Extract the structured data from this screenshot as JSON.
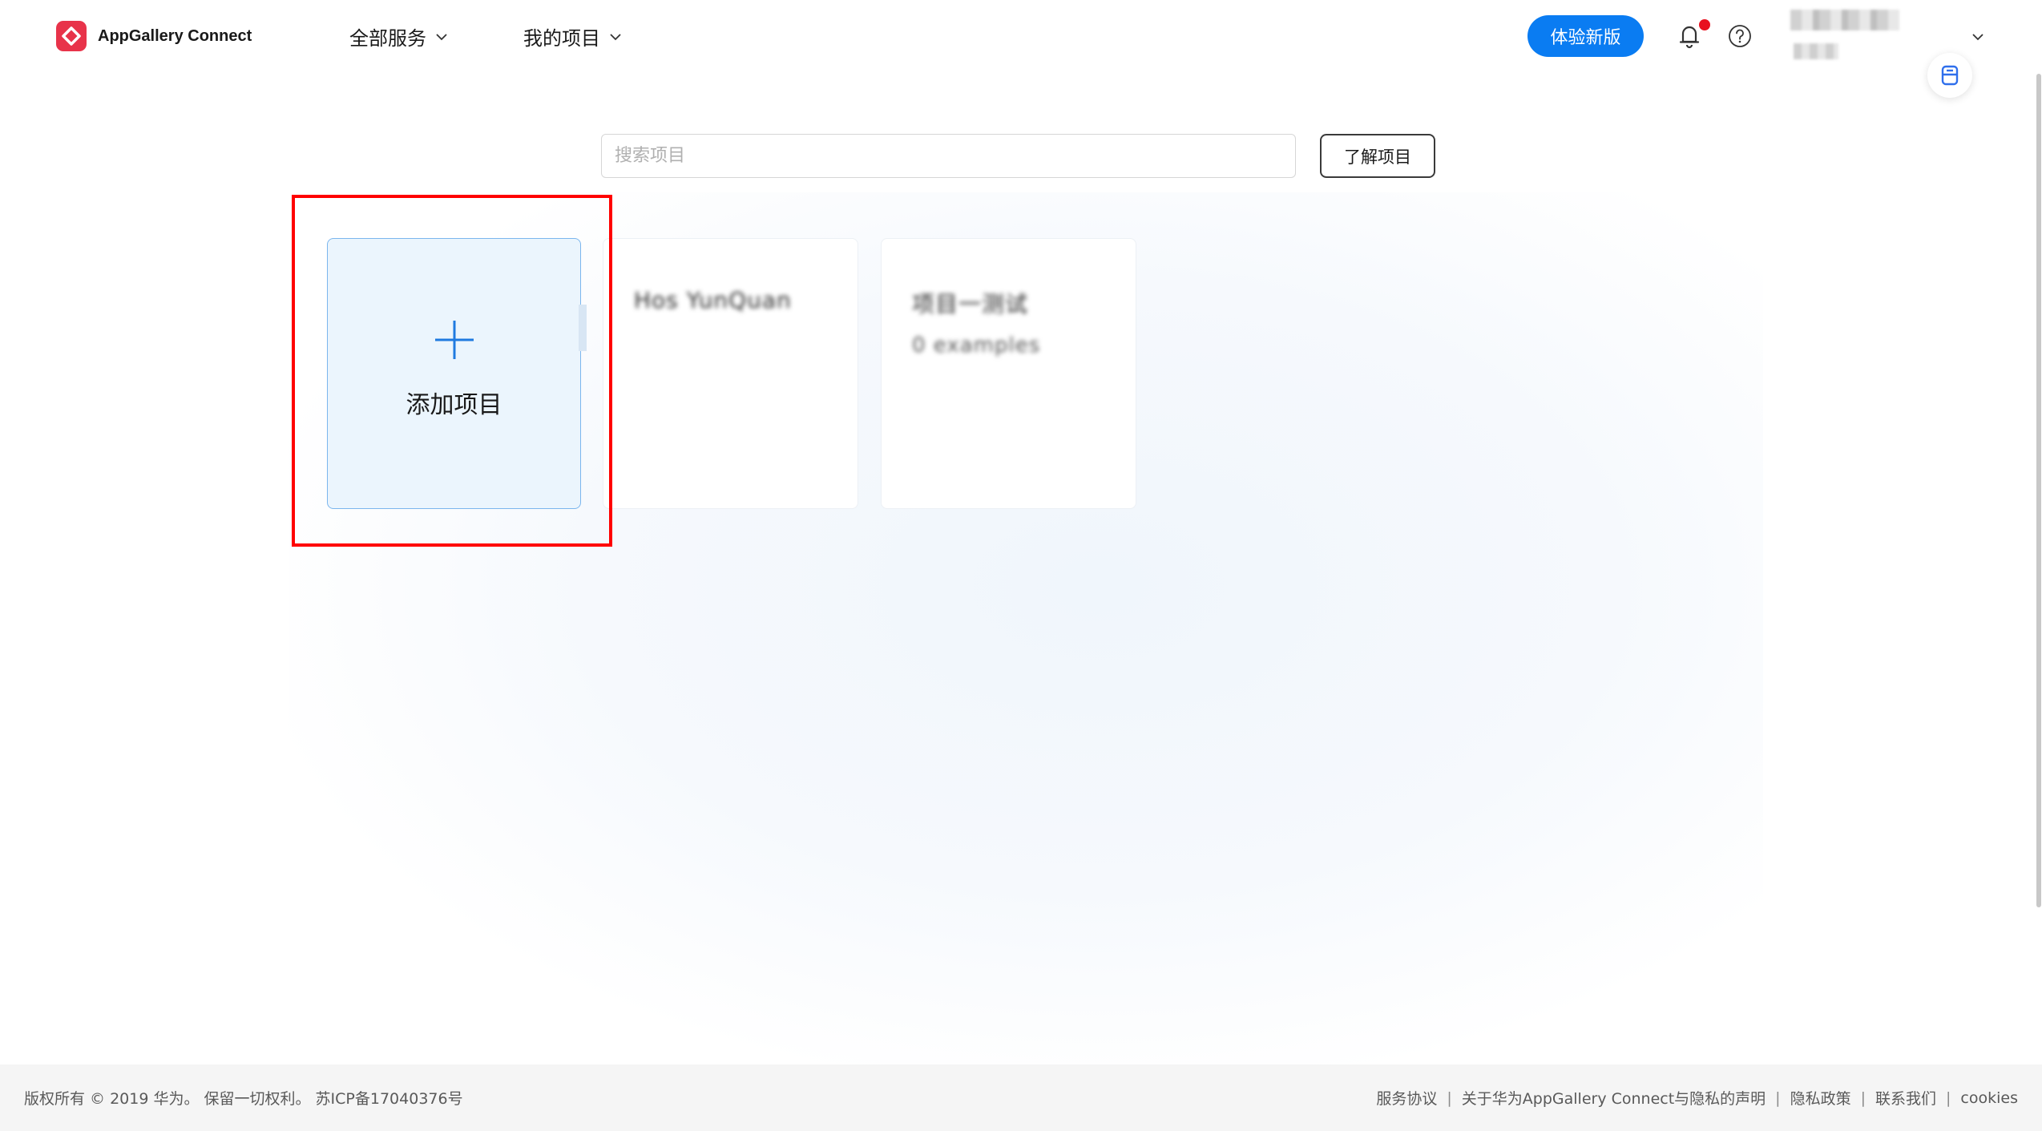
{
  "header": {
    "app_name": "AppGallery Connect",
    "nav": [
      {
        "label": "全部服务"
      },
      {
        "label": "我的项目"
      }
    ],
    "try_new_label": "体验新版",
    "notification_badge_color": "#e8101f",
    "accent_color": "#0a7cf2"
  },
  "search": {
    "placeholder": "搜索项目",
    "value": "",
    "learn_label": "了解项目"
  },
  "add_card": {
    "label": "添加项目"
  },
  "projects": [
    {
      "name": "Hos YunQuan",
      "subtitle": ""
    },
    {
      "name": "项目一测试",
      "subtitle": "0 examples"
    }
  ],
  "highlight_color": "#ff0000",
  "footer": {
    "copyright": "版权所有 © 2019 华为。 保留一切权利。 苏ICP备17040376号",
    "links": [
      "服务协议",
      "关于华为AppGallery Connect与隐私的声明",
      "隐私政策",
      "联系我们",
      "cookies"
    ],
    "separator": "|"
  }
}
